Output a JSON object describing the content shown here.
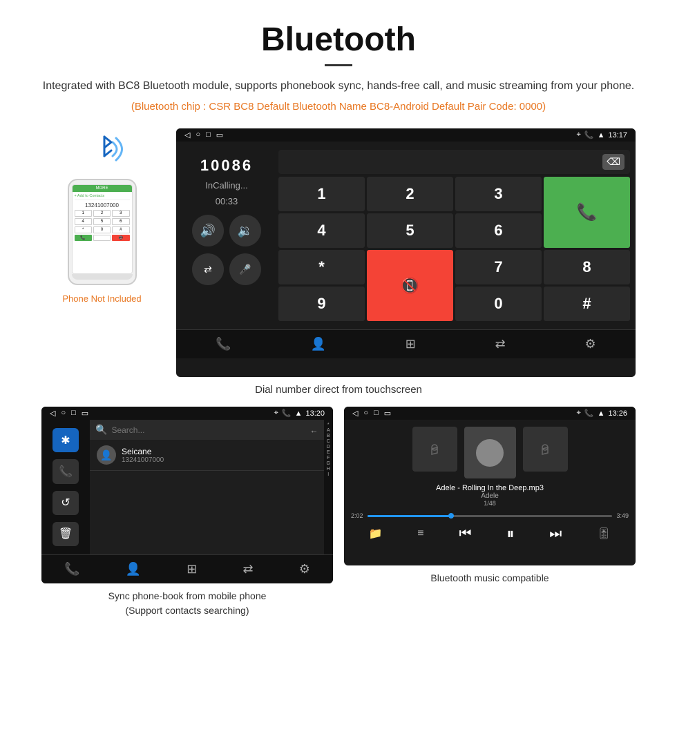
{
  "title": "Bluetooth",
  "title_divider": true,
  "description": "Integrated with BC8 Bluetooth module, supports phonebook sync, hands-free call, and music streaming from your phone.",
  "orange_note": "(Bluetooth chip : CSR BC8    Default Bluetooth Name BC8-Android    Default Pair Code: 0000)",
  "phone_not_included": "Phone Not Included",
  "dial_caption": "Dial number direct from touchscreen",
  "phonebook_caption": "Sync phone-book from mobile phone\n(Support contacts searching)",
  "music_caption": "Bluetooth music compatible",
  "dialer": {
    "number": "10086",
    "status": "InCalling...",
    "time": "00:33",
    "status_bar_time": "13:17"
  },
  "phonebook": {
    "status_bar_time": "13:20",
    "contact_name": "Seicane",
    "contact_number": "13241007000",
    "alphabet": [
      "*",
      "A",
      "B",
      "C",
      "D",
      "E",
      "F",
      "G",
      "H",
      "I"
    ]
  },
  "music": {
    "status_bar_time": "13:26",
    "song_title": "Adele - Rolling In the Deep.mp3",
    "artist": "Adele",
    "track_info": "1/48",
    "time_current": "2:02",
    "time_total": "3:49",
    "progress_percent": 35
  },
  "keypad": {
    "keys": [
      "1",
      "2",
      "3",
      "*",
      "4",
      "5",
      "6",
      "0",
      "7",
      "8",
      "9",
      "#"
    ]
  }
}
